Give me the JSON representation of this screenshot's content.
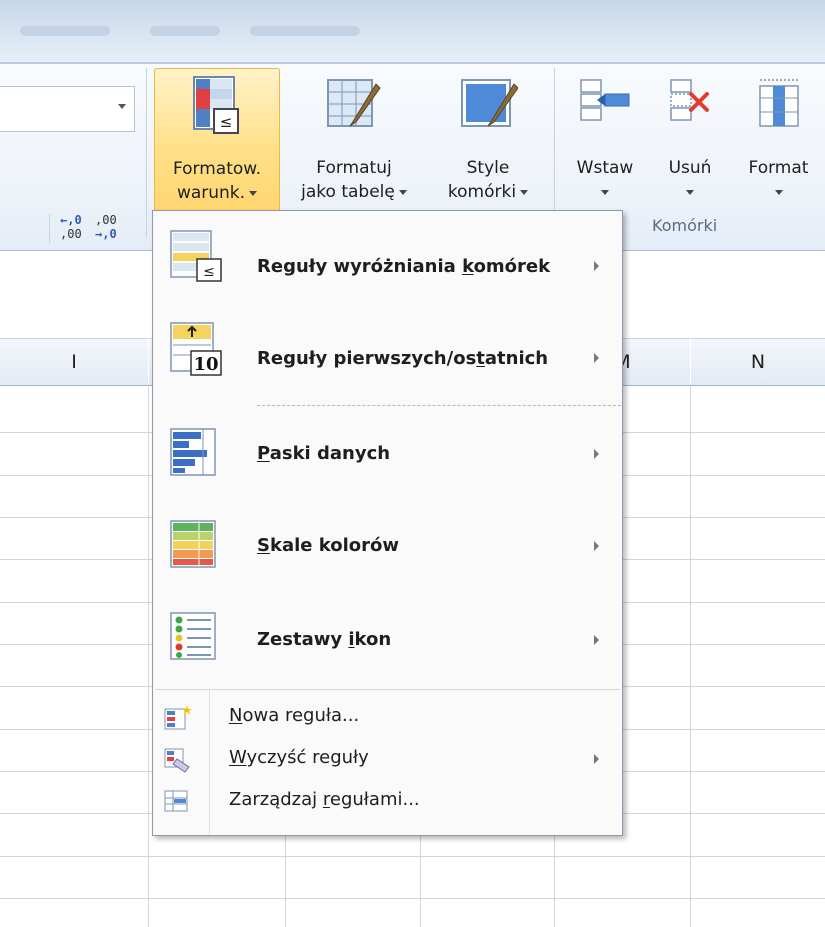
{
  "ribbon": {
    "number_group": {
      "increase_decimal": {
        "top": "←,0",
        "bottom": ",00"
      },
      "decrease_decimal": {
        "top": ",00",
        "bottom": "→,0"
      }
    },
    "buttons": {
      "conditional_formatting": {
        "line1": "Formatow.",
        "line2": "warunk."
      },
      "format_as_table": {
        "line1": "Formatuj",
        "line2": "jako tabelę"
      },
      "cell_styles": {
        "line1": "Style",
        "line2": "komórki"
      },
      "insert": {
        "line1": "Wstaw"
      },
      "delete": {
        "line1": "Usuń"
      },
      "format": {
        "line1": "Format"
      }
    },
    "cells_group_label": "Komórki"
  },
  "sheet": {
    "columns": [
      "I",
      "M",
      "N"
    ]
  },
  "menu": {
    "items": [
      {
        "pre": "Reguły wyróżniania ",
        "accel": "k",
        "post": "omórek",
        "icon": "highlight-cells-rules-icon",
        "submenu": true
      },
      {
        "pre": "Reguły pierwszych/os",
        "accel": "t",
        "post": "atnich",
        "icon": "top-bottom-rules-icon",
        "submenu": true,
        "icon_text": "10"
      },
      {
        "pre": "",
        "accel": "P",
        "post": "aski danych",
        "icon": "data-bars-icon",
        "submenu": true
      },
      {
        "pre": "",
        "accel": "S",
        "post": "kale kolorów",
        "icon": "color-scales-icon",
        "submenu": true
      },
      {
        "pre": "Zestawy ",
        "accel": "i",
        "post": "kon",
        "icon": "icon-sets-icon",
        "submenu": true
      }
    ],
    "small_items": [
      {
        "pre": "",
        "accel": "N",
        "post": "owa reguła...",
        "icon": "new-rule-icon",
        "submenu": false
      },
      {
        "pre": "",
        "accel": "W",
        "post": "yczyść reguły",
        "icon": "clear-rules-icon",
        "submenu": true
      },
      {
        "pre": "Zarządzaj ",
        "accel": "r",
        "post": "egułami...",
        "icon": "manage-rules-icon",
        "submenu": false
      }
    ]
  },
  "colors": {
    "active_button": "#ffd263",
    "ribbon_bg": "#eef3f9",
    "menu_bg": "#fafafa",
    "accent_blue": "#2c5fb0"
  }
}
